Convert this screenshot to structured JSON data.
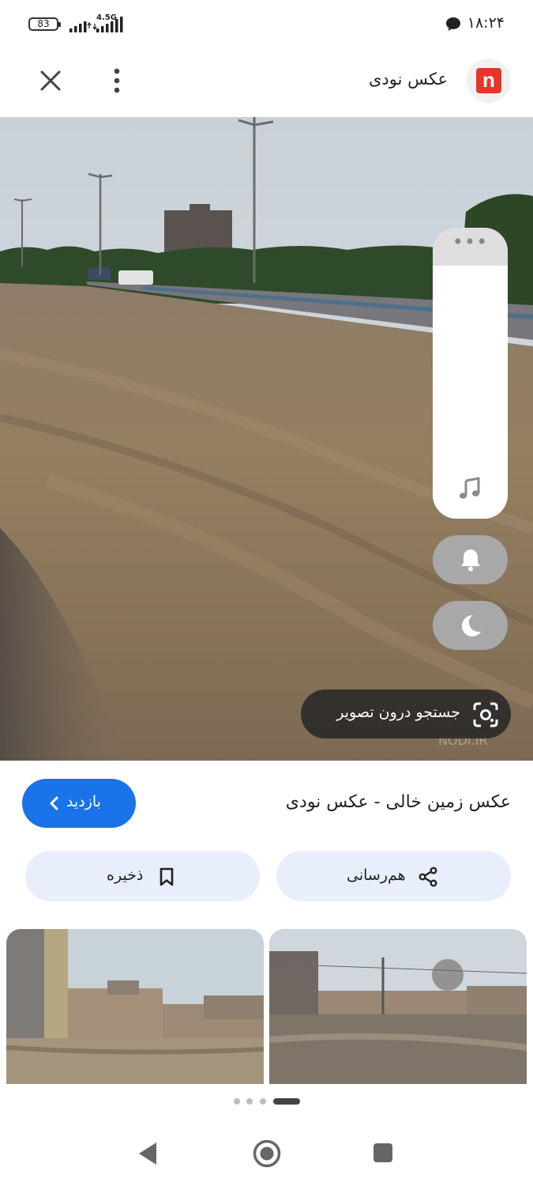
{
  "status_bar": {
    "battery": "83",
    "network": "4.5G",
    "time": "۱۸:۲۴"
  },
  "header": {
    "site_logo_letter": "n",
    "site_name": "عکس نودی",
    "icons": [
      "close-icon",
      "more-vert-icon"
    ]
  },
  "viewer": {
    "watermark": "NODI.IR",
    "side_panel_icons": [
      "more-horiz-icon",
      "music-note-icon"
    ],
    "buttons": [
      "bell-icon",
      "moon-icon"
    ],
    "lens_label": "جستجو درون تصویر"
  },
  "caption": "عکس زمین خالی - عکس نودی",
  "visit_button": "بازدید",
  "actions": {
    "share_label": "هم‌رسانی",
    "save_label": "ذخیره"
  },
  "related_count": 2,
  "carousel": {
    "dot_count": 4,
    "active_index": 3
  },
  "colors": {
    "accent": "#1a73e8",
    "action_bg": "#e8eefb",
    "logo_red": "#e53628"
  }
}
